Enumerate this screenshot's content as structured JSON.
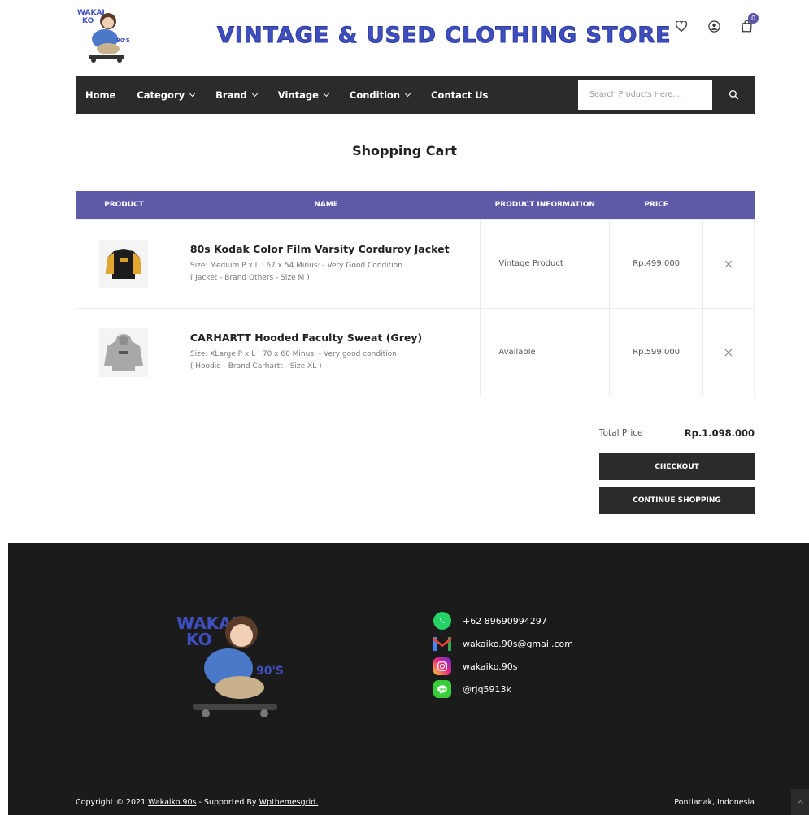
{
  "header": {
    "store_title": "VINTAGE & USED CLOTHING STORE",
    "logo_text_top": "WAKAI KO",
    "logo_text_side": "90'S",
    "cart_count": "0"
  },
  "nav": {
    "items": [
      {
        "label": "Home",
        "has_dropdown": false
      },
      {
        "label": "Category",
        "has_dropdown": true
      },
      {
        "label": "Brand",
        "has_dropdown": true
      },
      {
        "label": "Vintage",
        "has_dropdown": true
      },
      {
        "label": "Condition",
        "has_dropdown": true
      },
      {
        "label": "Contact Us",
        "has_dropdown": false
      }
    ],
    "search_placeholder": "Search Products Here...."
  },
  "cart": {
    "title": "Shopping Cart",
    "columns": [
      "PRODUCT",
      "NAME",
      "PRODUCT INFORMATION",
      "PRICE"
    ],
    "items": [
      {
        "name": "80s Kodak Color Film Varsity Corduroy Jacket",
        "detail1": "Size: Medium P x L : 67 x 54 Minus: - Very Good Condition",
        "detail2": "( Jacket - Brand Others - Size M )",
        "info": "Vintage Product",
        "price": "Rp.499.000"
      },
      {
        "name": "CARHARTT Hooded Faculty Sweat (Grey)",
        "detail1": "Size: XLarge P x L : 70 x 60 Minus: - Very good condition",
        "detail2": "( Hoodie - Brand Carhartt - Size XL )",
        "info": "Available",
        "price": "Rp.599.000"
      }
    ],
    "total_label": "Total Price",
    "total_value": "Rp.1.098.000",
    "checkout_label": "CHECKOUT",
    "continue_label": "CONTINUE SHOPPING"
  },
  "footer": {
    "contacts": [
      {
        "icon": "whatsapp-icon",
        "text": "+62 89690994297",
        "color": "#25d366"
      },
      {
        "icon": "gmail-icon",
        "text": "wakaiko.90s@gmail.com",
        "color": "#ea4335"
      },
      {
        "icon": "instagram-icon",
        "text": "wakaiko.90s",
        "color": "#d62976"
      },
      {
        "icon": "line-icon",
        "text": "@rjq5913k",
        "color": "#3acd3a"
      }
    ],
    "copyright_prefix": "Copyright © 2021",
    "copyright_link1": "Wakaiko.90s",
    "copyright_mid": "- Supported By",
    "copyright_link2": "Wpthemesgrid.",
    "location": "Pontianak, Indonesia"
  },
  "colors": {
    "accent": "#5e5aa8",
    "dark": "#2b2b2b",
    "footer_bg": "#1b1b1b"
  }
}
